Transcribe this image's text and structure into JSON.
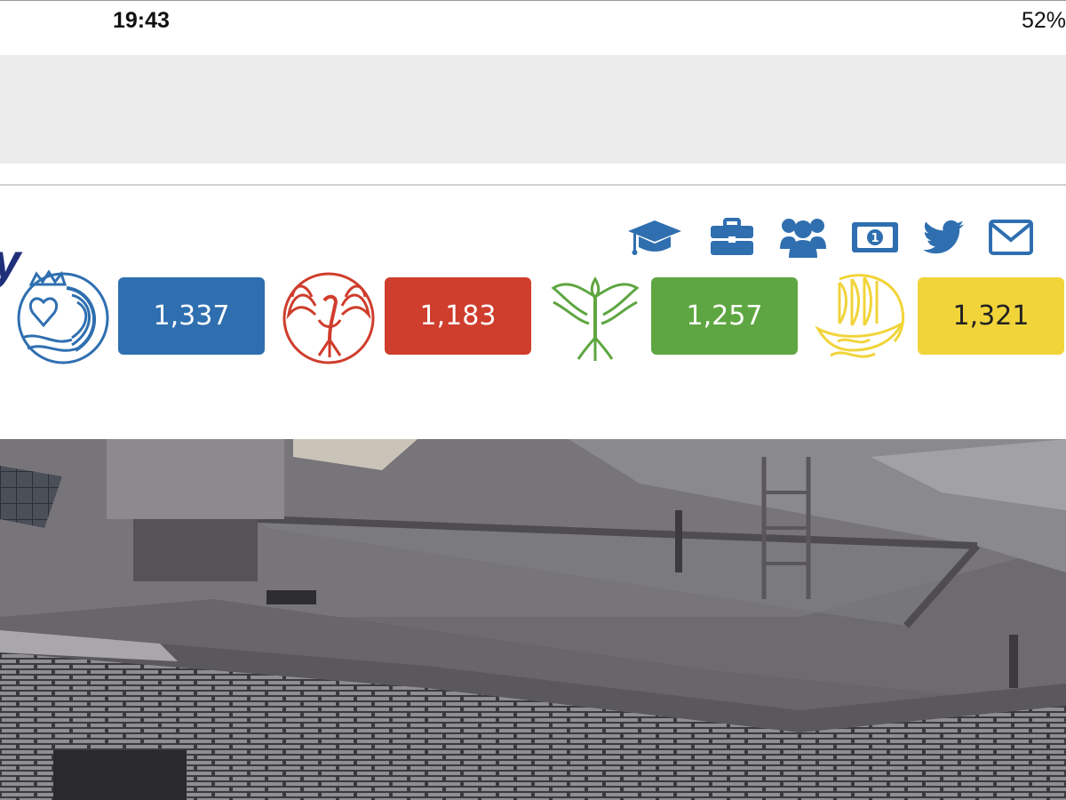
{
  "status_bar": {
    "time": "19:43",
    "battery": "52%"
  },
  "header": {
    "logo_fragment": "y",
    "icons": [
      "graduation-cap-icon",
      "briefcase-icon",
      "users-icon",
      "money-icon",
      "twitter-icon",
      "envelope-icon"
    ]
  },
  "houses": [
    {
      "crest": "crowned-heart-wave-crest",
      "score": "1,337",
      "color": "#2f6fb0"
    },
    {
      "crest": "red-phoenix-crest",
      "score": "1,183",
      "color": "#cf3d2c"
    },
    {
      "crest": "green-phoenix-crest",
      "score": "1,257",
      "color": "#5ea641"
    },
    {
      "crest": "yellow-ship-crest",
      "score": "1,321",
      "color": "#f1d43a"
    }
  ],
  "colors": {
    "accent": "#2f6fb0",
    "divider": "#d0d0d0",
    "band": "#ececec"
  }
}
